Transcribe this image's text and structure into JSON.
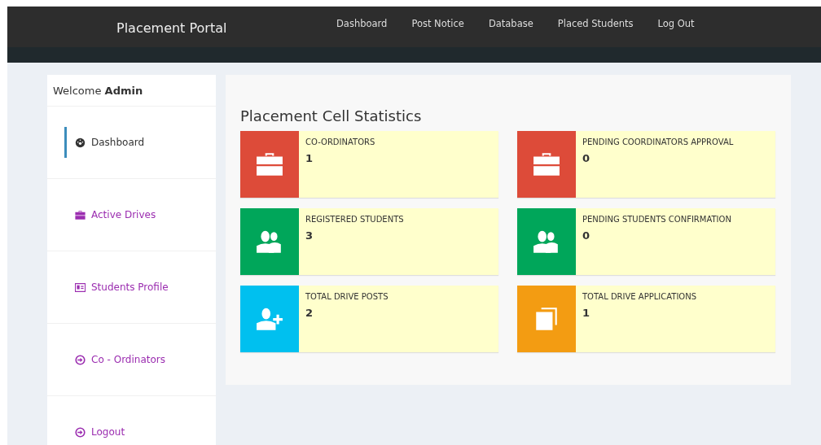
{
  "navbar": {
    "brand": "Placement Portal",
    "links": [
      {
        "label": "Dashboard"
      },
      {
        "label": "Post Notice"
      },
      {
        "label": "Database"
      },
      {
        "label": "Placed Students"
      },
      {
        "label": "Log Out"
      }
    ]
  },
  "sidebar": {
    "welcome": "Welcome **Admin**",
    "items": [
      {
        "label": "Dashboard",
        "selected": true
      },
      {
        "label": "Active Drives",
        "selected": false
      },
      {
        "label": "Students Profile",
        "selected": false
      },
      {
        "label": "Co - Ordinators",
        "selected": false
      },
      {
        "label": "Logout",
        "selected": false
      }
    ]
  },
  "main": {
    "title": "Placement Cell Statistics",
    "stats": [
      {
        "label": "CO-ORDINATORS",
        "value": "1",
        "color": "#dd4b39"
      },
      {
        "label": "PENDING COORDINATORS APPROVAL",
        "value": "0",
        "color": "#dd4b39"
      },
      {
        "label": "REGISTERED STUDENTS",
        "value": "3",
        "color": "#00a65a"
      },
      {
        "label": "PENDING STUDENTS CONFIRMATION",
        "value": "0",
        "color": "#00a65a"
      },
      {
        "label": "TOTAL DRIVE POSTS",
        "value": "2",
        "color": "#00c0ef"
      },
      {
        "label": "TOTAL DRIVE APPLICATIONS",
        "value": "1",
        "color": "#f39c12"
      }
    ]
  }
}
